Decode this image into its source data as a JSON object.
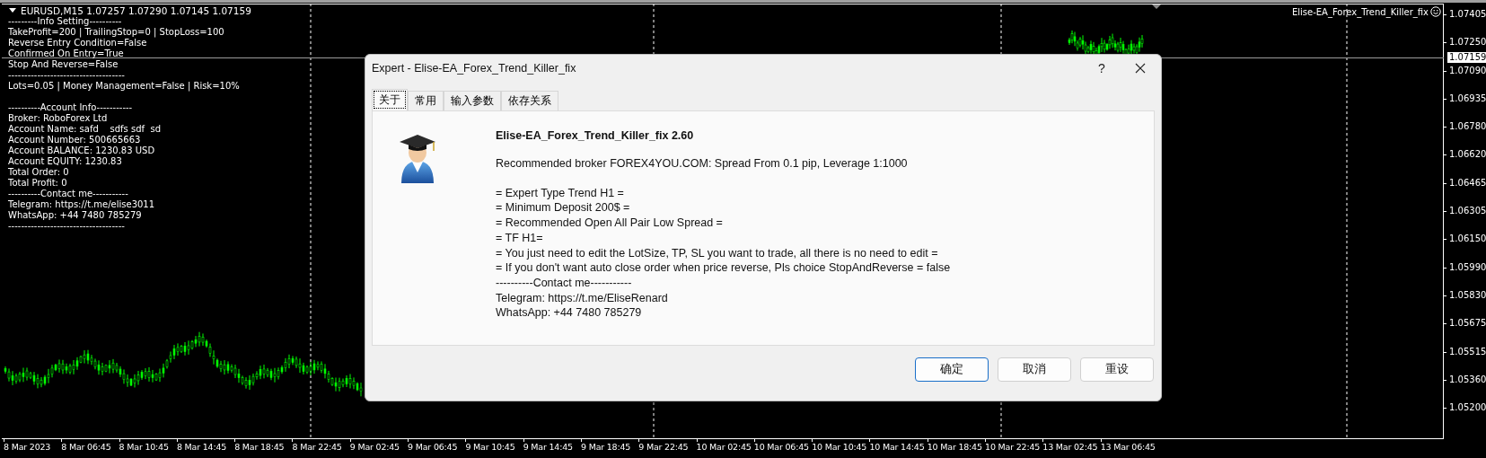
{
  "chart": {
    "header": "EURUSD,M15  1.07257 1.07290 1.07145 1.07159",
    "info_blocks": [
      [
        "---------Info Setting----------",
        "TakeProfit=200 | TrailingStop=0 | StopLoss=100",
        "Reverse Entry Condition=False",
        "Confirmed On Entry=True",
        "Stop And Reverse=False",
        "------------------------------------",
        "Lots=0.05 | Money Management=False | Risk=10%"
      ],
      [
        "----------Account Info-----------",
        "Broker: RoboForex Ltd",
        "Account Name: safd    sdfs sdf  sd",
        "Account Number: 500665663",
        "Account BALANCE: 1230.83 USD",
        "Account EQUITY: 1230.83",
        "Total Order: 0",
        "Total Profit: 0",
        "----------Contact me-----------",
        "Telegram: https://t.me/elise3011",
        "WhatsApp: +44 7480 785279",
        "------------------------------------"
      ]
    ],
    "expert_name": "Elise-EA_Forex_Trend_Killer_fix",
    "price_axis": [
      "1.07405",
      "1.07250",
      "1.07090",
      "1.06935",
      "1.06780",
      "1.06620",
      "1.06465",
      "1.06305",
      "1.06150",
      "1.05990",
      "1.05830",
      "1.05675",
      "1.05515",
      "1.05360",
      "1.05200"
    ],
    "current_price": "1.07159",
    "time_axis": [
      "8 Mar 2023",
      "8 Mar 06:45",
      "8 Mar 10:45",
      "8 Mar 14:45",
      "8 Mar 18:45",
      "8 Mar 22:45",
      "9 Mar 02:45",
      "9 Mar 06:45",
      "9 Mar 10:45",
      "9 Mar 14:45",
      "9 Mar 18:45",
      "9 Mar 22:45",
      "10 Mar 02:45",
      "10 Mar 06:45",
      "10 Mar 10:45",
      "10 Mar 14:45",
      "10 Mar 18:45",
      "10 Mar 22:45",
      "13 Mar 02:45",
      "13 Mar 06:45"
    ]
  },
  "dialog": {
    "title": "Expert - Elise-EA_Forex_Trend_Killer_fix",
    "help": "?",
    "tabs": [
      {
        "label": "关于",
        "selected": true
      },
      {
        "label": "常用",
        "selected": false
      },
      {
        "label": "输入参数",
        "selected": false
      },
      {
        "label": "依存关系",
        "selected": false
      }
    ],
    "heading": "Elise-EA_Forex_Trend_Killer_fix 2.60",
    "paragraphs": [
      [
        "Recommended broker FOREX4YOU.COM: Spread From 0.1 pip, Leverage 1:1000"
      ],
      [
        "= Expert Type Trend H1 =",
        "= Minimum Deposit 200$ =",
        "= Recommended Open All Pair Low Spread =",
        "= TF H1=",
        "= You just need to edit the LotSize, TP, SL you want to trade, all there is no need to edit =",
        "= If you don't want auto close order when price reverse, Pls choice StopAndReverse = false",
        "----------Contact me-----------",
        "Telegram: https://t.me/EliseRenard",
        "WhatsApp: +44 7480 785279"
      ]
    ],
    "buttons": [
      {
        "label": "确定",
        "primary": true
      },
      {
        "label": "取消",
        "primary": false
      },
      {
        "label": "重设",
        "primary": false
      }
    ]
  }
}
